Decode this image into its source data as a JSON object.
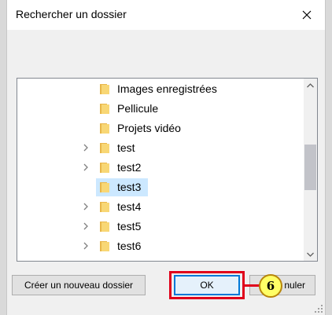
{
  "dialog": {
    "title": "Rechercher un dossier"
  },
  "tree": {
    "items": [
      {
        "label": "Images enregistrées",
        "expandable": false,
        "selected": false
      },
      {
        "label": "Pellicule",
        "expandable": false,
        "selected": false
      },
      {
        "label": "Projets vidéo",
        "expandable": false,
        "selected": false
      },
      {
        "label": "test",
        "expandable": true,
        "selected": false
      },
      {
        "label": "test2",
        "expandable": true,
        "selected": false
      },
      {
        "label": "test3",
        "expandable": false,
        "selected": true
      },
      {
        "label": "test4",
        "expandable": true,
        "selected": false
      },
      {
        "label": "test5",
        "expandable": true,
        "selected": false
      },
      {
        "label": "test6",
        "expandable": true,
        "selected": false
      }
    ]
  },
  "buttons": {
    "new_folder": "Créer un nouveau dossier",
    "ok": "OK",
    "cancel": "nuler"
  },
  "annotation": {
    "step": "6"
  },
  "colors": {
    "folder": "#f8d775",
    "selection": "#cce8ff",
    "highlight": "#e0001a",
    "callout": "#ffff66"
  }
}
